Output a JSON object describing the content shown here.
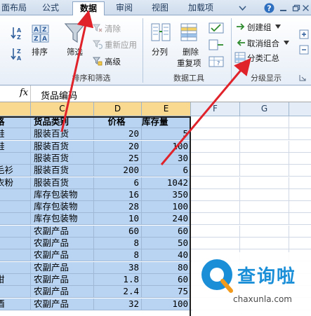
{
  "tabs": [
    {
      "label": "面布局",
      "active": false
    },
    {
      "label": "公式",
      "active": false
    },
    {
      "label": "数据",
      "active": true
    },
    {
      "label": "审阅",
      "active": false
    },
    {
      "label": "视图",
      "active": false
    },
    {
      "label": "加载项",
      "active": false
    }
  ],
  "ribbon": {
    "sort_filter": {
      "sort_label": "排序",
      "filter_label": "筛选",
      "clear_label": "清除",
      "reapply_label": "重新应用",
      "advanced_label": "高级",
      "group_label": "排序和筛选"
    },
    "data_tools": {
      "split_label": "分列",
      "remove_dup_label_1": "删除",
      "remove_dup_label_2": "重复项",
      "group_label": "数据工具"
    },
    "outline": {
      "create_group_label": "创建组",
      "ungroup_label": "取消组合",
      "subtotal_label": "分类汇总",
      "group_label": "分级显示"
    }
  },
  "formula_bar": {
    "fx": "fx",
    "value": "货品编码"
  },
  "columns": [
    "C",
    "D",
    "E",
    "F",
    "G"
  ],
  "rows": [
    {
      "b": "格",
      "c": "货品类别",
      "d": "价格",
      "e": "库存量",
      "header": true
    },
    {
      "b": "鞋",
      "c": "服装百货",
      "d": "20",
      "e": "5"
    },
    {
      "b": "鞋",
      "c": "服装百货",
      "d": "20",
      "e": "100"
    },
    {
      "b": "",
      "c": "服装百货",
      "d": "25",
      "e": "30"
    },
    {
      "b": "毛衫",
      "c": "服装百货",
      "d": "200",
      "e": "6"
    },
    {
      "b": "衣粉",
      "c": "服装百货",
      "d": "6",
      "e": "1042"
    },
    {
      "b": "",
      "c": "库存包装物",
      "d": "16",
      "e": "350"
    },
    {
      "b": "",
      "c": "库存包装物",
      "d": "28",
      "e": "100"
    },
    {
      "b": "",
      "c": "库存包装物",
      "d": "10",
      "e": "240"
    },
    {
      "b": "",
      "c": "农副产品",
      "d": "60",
      "e": "60"
    },
    {
      "b": "",
      "c": "农副产品",
      "d": "8",
      "e": "50"
    },
    {
      "b": "",
      "c": "农副产品",
      "d": "8",
      "e": "40"
    },
    {
      "b": "",
      "c": "农副产品",
      "d": "38",
      "e": "80"
    },
    {
      "b": "柑",
      "c": "农副产品",
      "d": "1.8",
      "e": "60"
    },
    {
      "b": "",
      "c": "农副产品",
      "d": "2.4",
      "e": "75"
    },
    {
      "b": "酒",
      "c": "农副产品",
      "d": "32",
      "e": "100"
    }
  ],
  "watermark": {
    "name": "查询啦",
    "url": "chaxunla.com"
  },
  "colors": {
    "selection": "#b8d4f2",
    "arrow": "#e0222b",
    "watermark_blue": "#1a8fd8"
  }
}
